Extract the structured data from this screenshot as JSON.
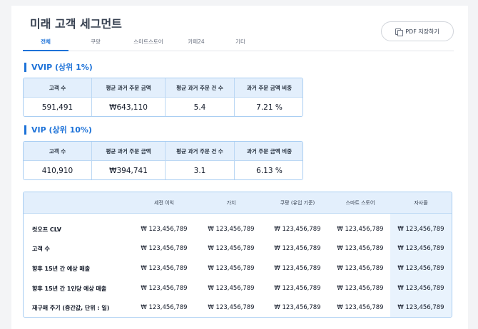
{
  "page": {
    "title": "미래 고객 세그먼트",
    "pdf_button": "PDF 저장하기"
  },
  "tabs": [
    "전체",
    "쿠팡",
    "스마트스토어",
    "카페24",
    "기타"
  ],
  "vvip": {
    "title": "VVIP (상위 1%)",
    "headers": [
      "고객 수",
      "평균 과거 주문 금액",
      "평균 과거 주문 건 수",
      "과거 주문 금액 비중"
    ],
    "values": [
      "591,491",
      "₩643,110",
      "5.4",
      "7.21 %"
    ]
  },
  "vip": {
    "title": "VIP (상위 10%)",
    "headers": [
      "고객 수",
      "평균 과거 주문 금액",
      "평균 과거 주문 건 수",
      "과거 주문 금액 비중"
    ],
    "values": [
      "410,910",
      "₩394,741",
      "3.1",
      "6.13 %"
    ]
  },
  "forecast": {
    "headers": [
      "세전 이익",
      "가치",
      "쿠팡 (유입 기준)",
      "스마트 스토어",
      "자사몰"
    ],
    "rows": [
      {
        "label": "컷오프 CLV",
        "cells": [
          "₩ 123,456,789",
          "₩ 123,456,789",
          "₩ 123,456,789",
          "₩ 123,456,789",
          "₩ 123,456,789"
        ]
      },
      {
        "label": "고객 수",
        "cells": [
          "₩ 123,456,789",
          "₩ 123,456,789",
          "₩ 123,456,789",
          "₩ 123,456,789",
          "₩ 123,456,789"
        ]
      },
      {
        "label": "향후 15년 간 예상 매출",
        "cells": [
          "₩ 123,456,789",
          "₩ 123,456,789",
          "₩ 123,456,789",
          "₩ 123,456,789",
          "₩ 123,456,789"
        ]
      },
      {
        "label": "향후 15년 간 1인당 예상 매출",
        "cells": [
          "₩ 123,456,789",
          "₩ 123,456,789",
          "₩ 123,456,789",
          "₩ 123,456,789",
          "₩ 123,456,789"
        ]
      },
      {
        "label": "재구매 주기 (중간값, 단위 : 일)",
        "cells": [
          "₩ 123,456,789",
          "₩ 123,456,789",
          "₩ 123,456,789",
          "₩ 123,456,789",
          "₩ 123,456,789"
        ]
      }
    ]
  },
  "colors": {
    "accent": "#1d72d8",
    "header_bg": "#e3effc",
    "border": "#a8cdf2"
  },
  "icons": {
    "pdf_button": "copy-icon"
  }
}
